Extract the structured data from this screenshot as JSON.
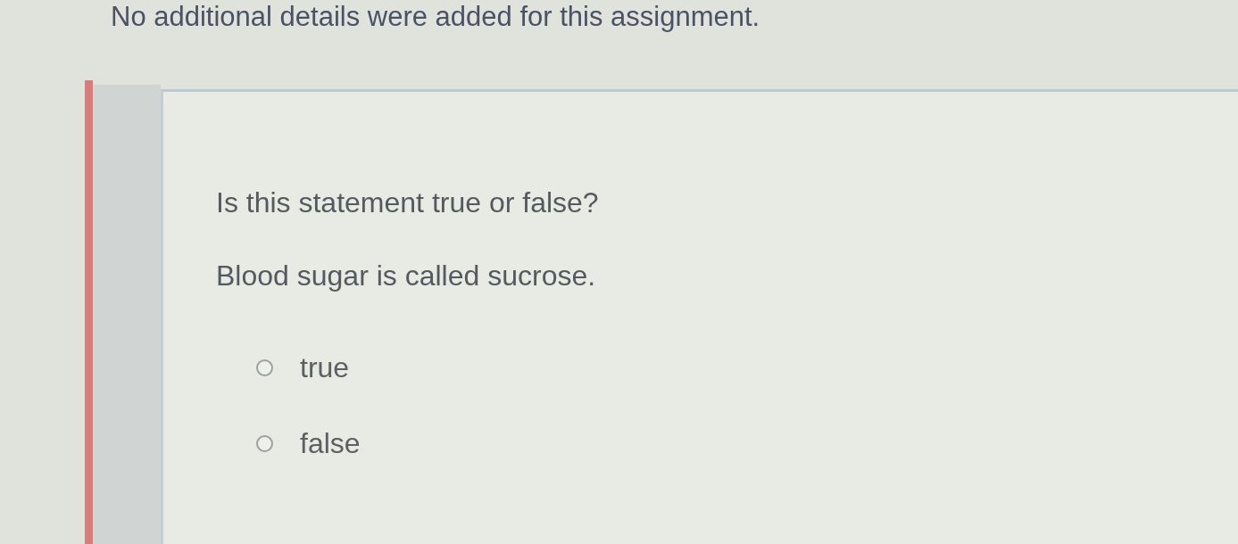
{
  "header": {
    "text": "No additional details were added for this assignment."
  },
  "question": {
    "prompt": "Is this statement true or false?",
    "statement": "Blood sugar is called sucrose.",
    "options": [
      {
        "label": "true",
        "selected": false
      },
      {
        "label": "false",
        "selected": false
      }
    ]
  }
}
